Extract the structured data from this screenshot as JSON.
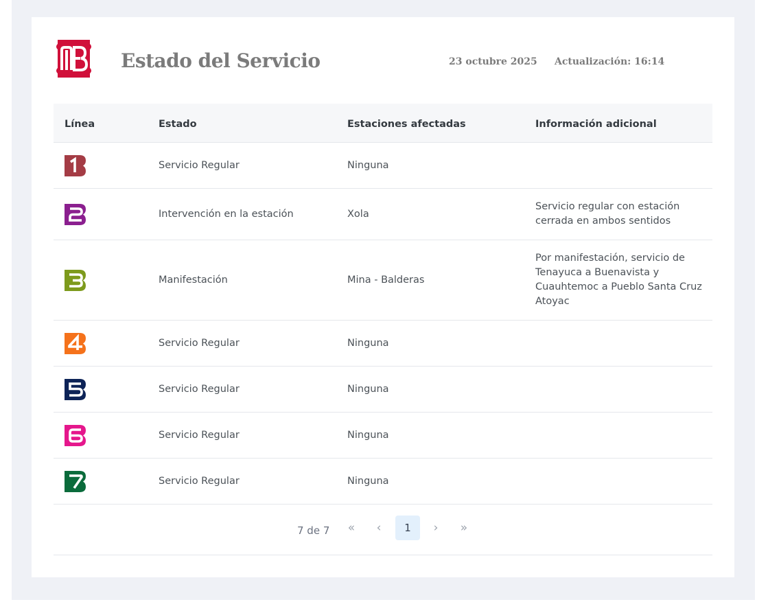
{
  "header": {
    "title": "Estado del Servicio",
    "date": "23 octubre 2025",
    "updated": "Actualización: 16:14"
  },
  "table": {
    "columns": [
      "Línea",
      "Estado",
      "Estaciones afectadas",
      "Información adicional"
    ],
    "rows": [
      {
        "line": "1",
        "status": "Servicio Regular",
        "stations": "Ninguna",
        "info": ""
      },
      {
        "line": "2",
        "status": "Intervención en la estación",
        "stations": "Xola",
        "info": "Servicio regular con estación cerrada en ambos sentidos"
      },
      {
        "line": "3",
        "status": "Manifestación",
        "stations": "Mina - Balderas",
        "info": "Por manifestación, servicio de Tenayuca a Buenavista y Cuauhtemoc a Pueblo Santa Cruz Atoyac"
      },
      {
        "line": "4",
        "status": "Servicio Regular",
        "stations": "Ninguna",
        "info": ""
      },
      {
        "line": "5",
        "status": "Servicio Regular",
        "stations": "Ninguna",
        "info": ""
      },
      {
        "line": "6",
        "status": "Servicio Regular",
        "stations": "Ninguna",
        "info": ""
      },
      {
        "line": "7",
        "status": "Servicio Regular",
        "stations": "Ninguna",
        "info": ""
      }
    ]
  },
  "pagination": {
    "summary": "7 de 7",
    "first": "«",
    "prev": "‹",
    "current": "1",
    "next": "›",
    "last": "»"
  },
  "colors": {
    "brand": "#d0103a",
    "line_1": "#a43c45",
    "line_2": "#8b1f8f",
    "line_3": "#7d9a1c",
    "line_4": "#f5721b",
    "line_5": "#0d2357",
    "line_6": "#e5178c",
    "line_7": "#0a6b3b"
  },
  "icons": {
    "logo": "metro-logo",
    "line_badges": "metro-line-number-badge"
  }
}
